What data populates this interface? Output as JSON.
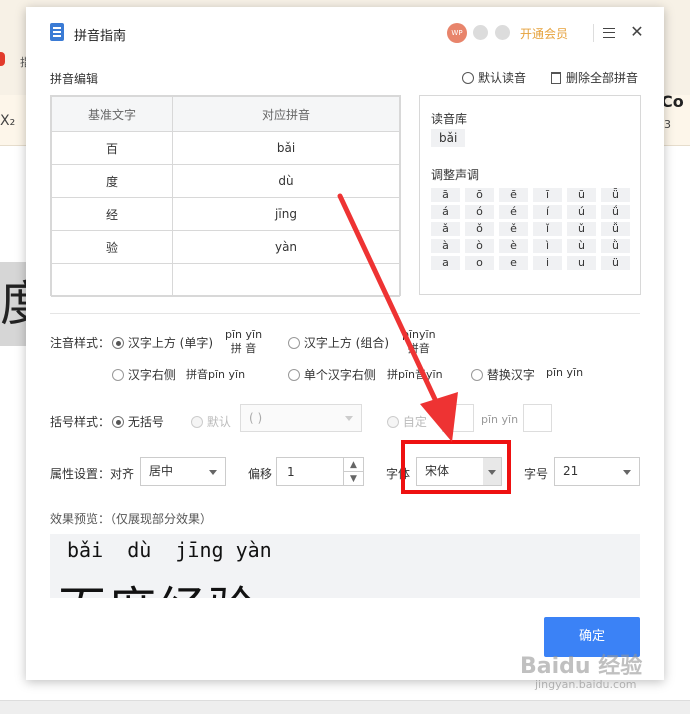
{
  "dialog": {
    "title": "拼音指南",
    "avatar_text": "WP",
    "vip_label": "开通会员"
  },
  "edit": {
    "section_label": "拼音编辑",
    "reset_label": "默认读音",
    "delete_label": "删除全部拼音",
    "table": {
      "headers": [
        "基准文字",
        "对应拼音"
      ],
      "rows": [
        {
          "char": "百",
          "pinyin": "bǎi"
        },
        {
          "char": "度",
          "pinyin": "dù"
        },
        {
          "char": "经",
          "pinyin": "jīng"
        },
        {
          "char": "验",
          "pinyin": "yàn"
        },
        {
          "char": "",
          "pinyin": ""
        }
      ]
    }
  },
  "library": {
    "title": "读音库",
    "current": "bǎi",
    "tone_title": "调整声调",
    "tones": [
      [
        "ā",
        "ō",
        "ē",
        "ī",
        "ū",
        "ǖ"
      ],
      [
        "á",
        "ó",
        "é",
        "í",
        "ú",
        "ǘ"
      ],
      [
        "ǎ",
        "ǒ",
        "ě",
        "ǐ",
        "ǔ",
        "ǚ"
      ],
      [
        "à",
        "ò",
        "è",
        "ì",
        "ù",
        "ǜ"
      ],
      [
        "a",
        "o",
        "e",
        "i",
        "u",
        "ü"
      ]
    ]
  },
  "notation": {
    "label": "注音样式：",
    "opt_above_single": "汉字上方 (单字)",
    "sample_single_top": "pīn yīn",
    "sample_single_bottom": "拼  音",
    "opt_above_group": "汉字上方 (组合)",
    "sample_group_top": "pīnyīn",
    "sample_group_bottom": "拼音",
    "opt_right": "汉字右侧",
    "sample_right": "拼音pīn yīn",
    "opt_single_right": "单个汉字右侧",
    "sample_single_right": "拼pīn音yīn",
    "opt_replace": "替换汉字",
    "sample_replace": "pīn yīn"
  },
  "bracket": {
    "label": "括号样式：",
    "opt_none": "无括号",
    "opt_default": "默认",
    "default_value": "( )",
    "opt_custom": "自定",
    "sample": "pīn yīn"
  },
  "attrs": {
    "label": "属性设置：",
    "align_label": "对齐",
    "align_value": "居中",
    "offset_label": "偏移",
    "offset_value": "1",
    "font_label": "字体",
    "font_value": "宋体",
    "size_label": "字号",
    "size_value": "21"
  },
  "preview": {
    "label": "效果预览：（仅展现部分效果）",
    "pinyin_line": "bǎi  dù  jīng yàn",
    "chars": "百度经验"
  },
  "ok_label": "确定",
  "watermark": {
    "brand": "Baidu 经验",
    "url": "jingyan.baidu.com"
  },
  "background": {
    "right_text": "oCo",
    "right_num": "3",
    "left_x": "X₂",
    "left_char": "指",
    "big_char": "度"
  },
  "colors": {
    "accent": "#3b82f6",
    "highlight": "#ee1111",
    "vip": "#e6a23c"
  }
}
